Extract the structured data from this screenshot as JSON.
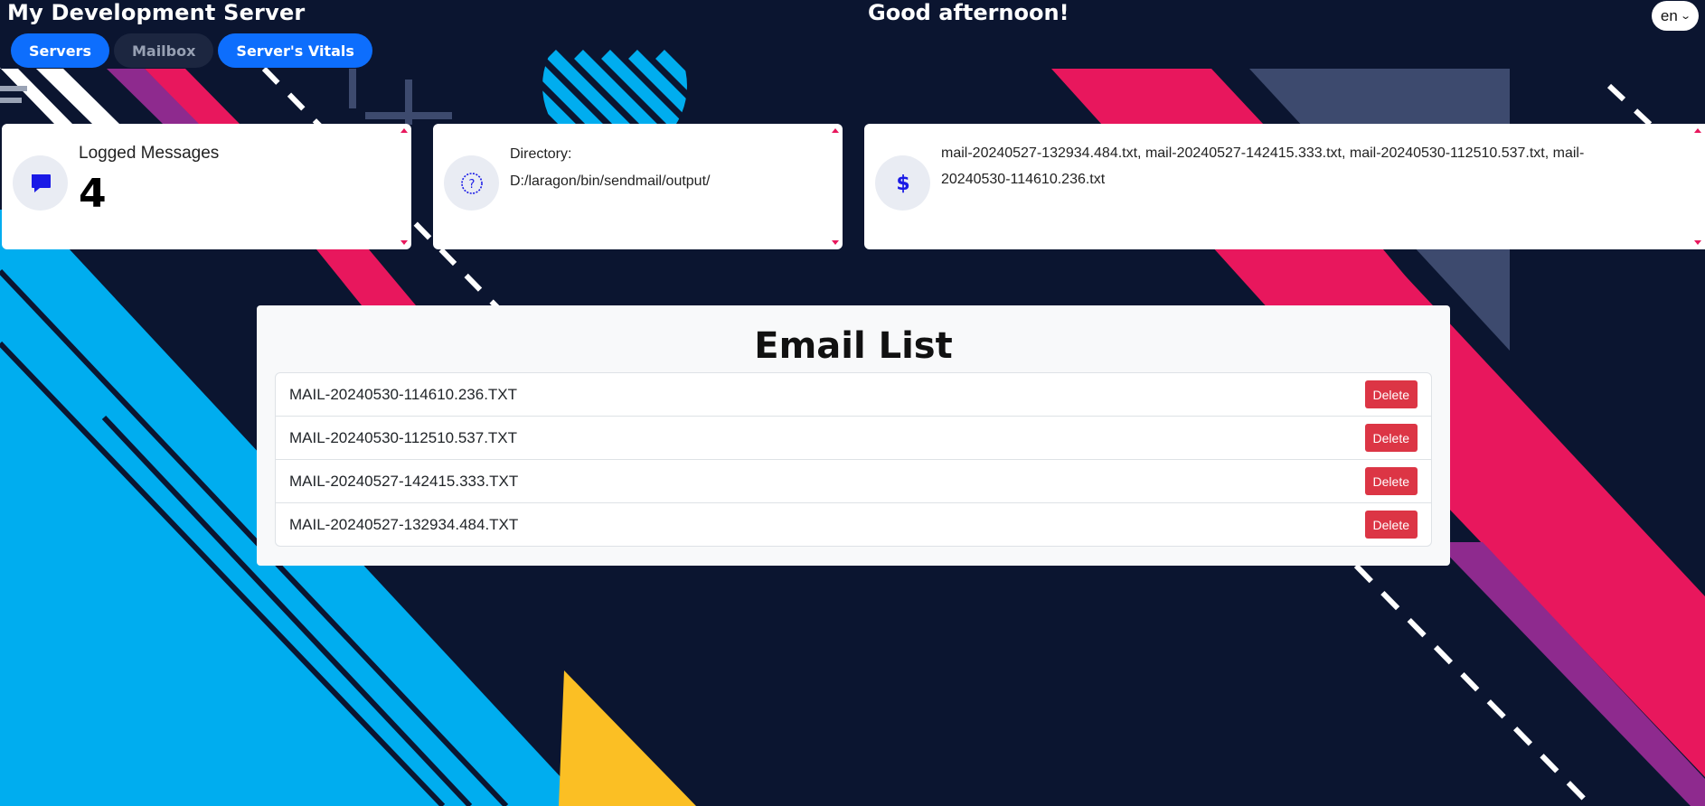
{
  "header": {
    "app_title": "My Development Server",
    "greeting": "Good afternoon!",
    "language": {
      "selected": "en"
    }
  },
  "nav": {
    "tabs": [
      {
        "label": "Servers",
        "active": true
      },
      {
        "label": "Mailbox",
        "active": false
      },
      {
        "label": "Server's Vitals",
        "active": true
      }
    ]
  },
  "cards": {
    "logged": {
      "label": "Logged Messages",
      "count": "4",
      "icon": "chat-bubble-icon"
    },
    "directory": {
      "label": "Directory:",
      "path": "D:/laragon/bin/sendmail/output/",
      "icon": "question-circle-icon"
    },
    "files": {
      "text": "mail-20240527-132934.484.txt, mail-20240527-142415.333.txt, mail-20240530-112510.537.txt, mail-20240530-114610.236.txt",
      "icon": "dollar-icon"
    }
  },
  "email_list": {
    "title": "Email List",
    "delete_label": "Delete",
    "items": [
      "MAIL-20240530-114610.236.TXT",
      "MAIL-20240530-112510.537.TXT",
      "MAIL-20240527-142415.333.TXT",
      "MAIL-20240527-132934.484.TXT"
    ]
  },
  "colors": {
    "background": "#0b1530",
    "primary": "#0d6efd",
    "danger": "#dc3545",
    "accent_pink": "#e8175d",
    "accent_blue": "#00adef",
    "accent_purple": "#8e2a8e",
    "accent_yellow": "#fbbf24",
    "accent_slate": "#3d4a6e"
  }
}
